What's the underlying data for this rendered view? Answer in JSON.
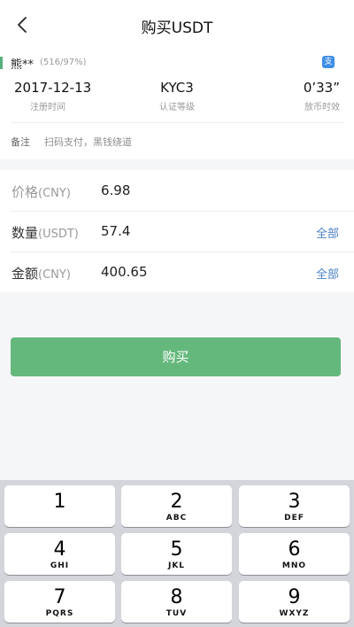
{
  "header": {
    "title": "购买USDT",
    "back_icon": "chevron-left-icon"
  },
  "merchant": {
    "name": "熊**",
    "stats": "(516/97%)",
    "pay_icon": "支",
    "register": {
      "value": "2017-12-13",
      "label": "注册时间"
    },
    "kyc": {
      "value": "KYC3",
      "label": "认证等级"
    },
    "release": {
      "value": "0’33”",
      "label": "放币时效"
    },
    "remark_label": "备注",
    "remark_value": "扫码支付，黑钱绕道"
  },
  "form": {
    "price": {
      "label": "价格",
      "unit": "(CNY)",
      "value": "6.98"
    },
    "quantity": {
      "label": "数量",
      "unit": "(USDT)",
      "value": "57.4",
      "all_label": "全部"
    },
    "amount": {
      "label": "金额",
      "unit": "(CNY)",
      "value": "400.65",
      "all_label": "全部"
    }
  },
  "buy_button": {
    "label": "购买"
  },
  "keypad": [
    {
      "num": "1",
      "letters": ""
    },
    {
      "num": "2",
      "letters": "ABC"
    },
    {
      "num": "3",
      "letters": "DEF"
    },
    {
      "num": "4",
      "letters": "GHI"
    },
    {
      "num": "5",
      "letters": "JKL"
    },
    {
      "num": "6",
      "letters": "MNO"
    },
    {
      "num": "7",
      "letters": "PQRS"
    },
    {
      "num": "8",
      "letters": "TUV"
    },
    {
      "num": "9",
      "letters": "WXYZ"
    }
  ],
  "colors": {
    "accent_green": "#65b87c",
    "link_blue": "#4b82c8",
    "alipay_blue": "#3f8ee8"
  }
}
